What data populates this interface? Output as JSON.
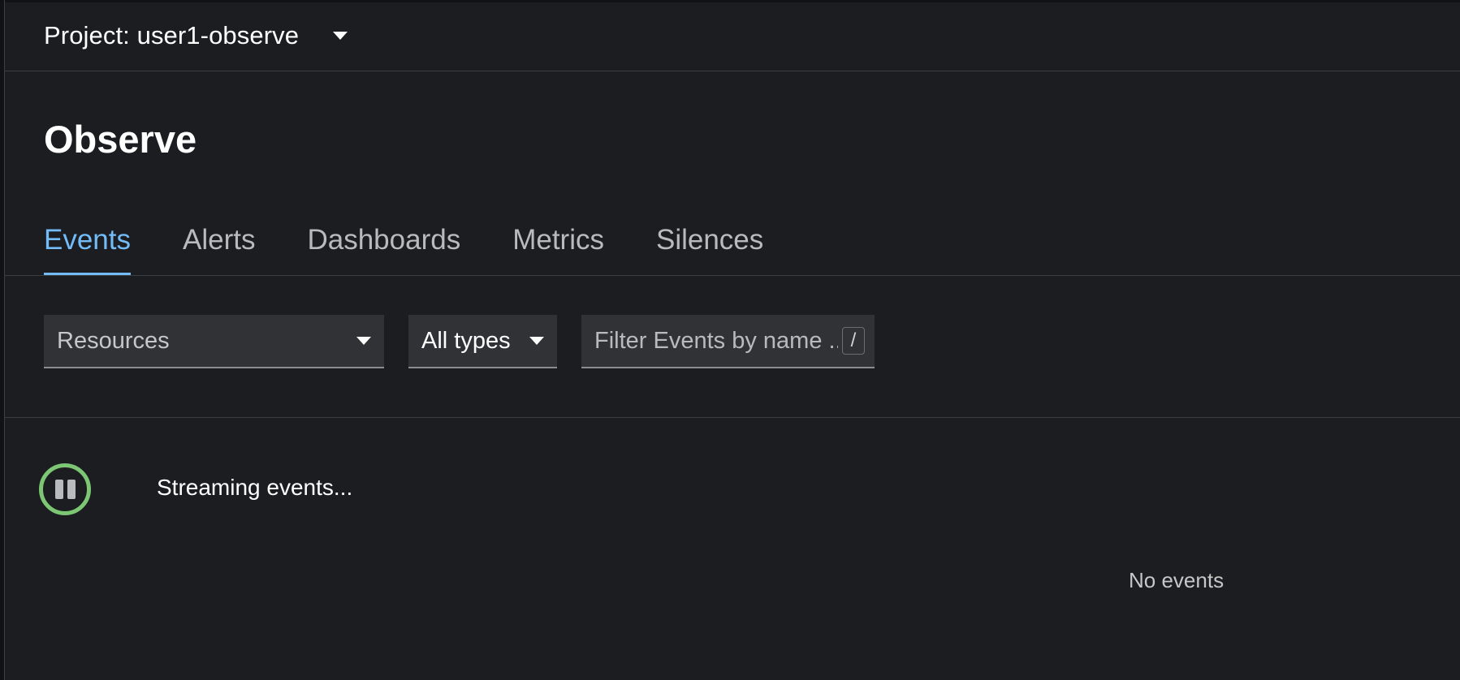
{
  "header": {
    "project_label": "Project: user1-observe"
  },
  "page": {
    "title": "Observe"
  },
  "tabs": [
    {
      "label": "Events",
      "active": true
    },
    {
      "label": "Alerts",
      "active": false
    },
    {
      "label": "Dashboards",
      "active": false
    },
    {
      "label": "Metrics",
      "active": false
    },
    {
      "label": "Silences",
      "active": false
    }
  ],
  "filters": {
    "resources_placeholder": "Resources",
    "type_value": "All types",
    "search_placeholder": "Filter Events by name ...",
    "search_shortcut": "/"
  },
  "stream": {
    "status": "Streaming events..."
  },
  "events": {
    "empty_message": "No events"
  },
  "colors": {
    "background": "#1b1d21",
    "active_tab": "#73bcf7",
    "stream_ring": "#7cc674",
    "input_background": "#303236"
  },
  "icons": {
    "project_dropdown": "caret-down-icon",
    "pause": "pause-icon"
  }
}
